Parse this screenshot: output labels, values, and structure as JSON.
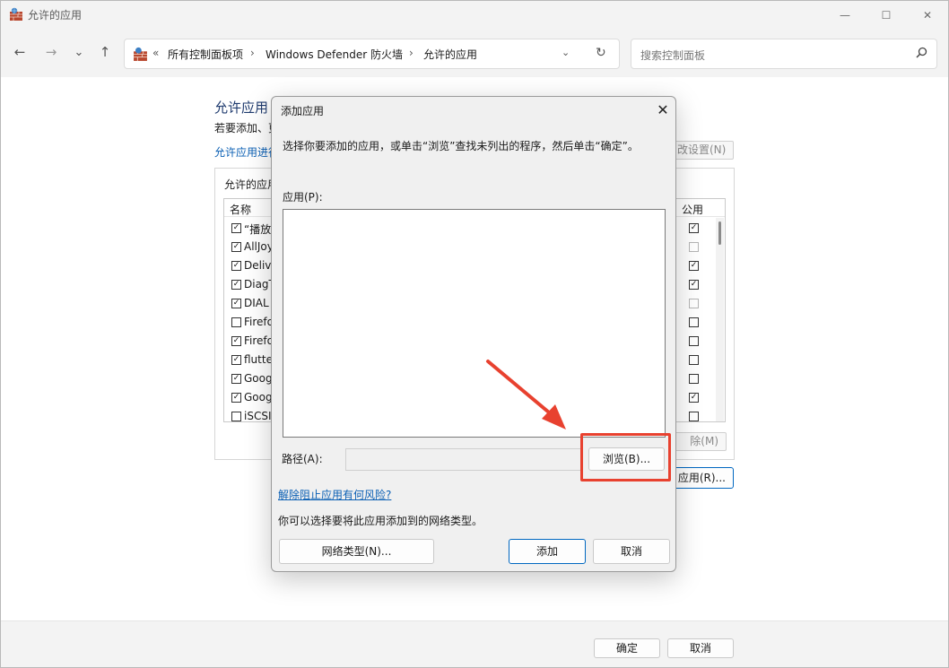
{
  "window": {
    "title": "允许的应用",
    "controls": {
      "minimize": "—",
      "maximize": "☐",
      "close": "✕"
    }
  },
  "nav": {
    "back": "←",
    "forward": "→",
    "recent": "⌄",
    "up": "↑",
    "breadcrumb_prefix": "«",
    "breadcrumbs": [
      "所有控制面板项",
      "Windows Defender 防火墙",
      "允许的应用"
    ],
    "separator": "›",
    "dropdown": "⌄",
    "refresh": "↻",
    "search_placeholder": "搜索控制面板"
  },
  "page": {
    "title": "允许应用",
    "description": "若要添加、更",
    "link": "允许应用进行",
    "change_settings": "改设置(N)",
    "group_label": "允许的应用",
    "columns": {
      "name": "名称",
      "public": "公用"
    },
    "rows": [
      {
        "name": "“播放到",
        "checked": true,
        "public": true,
        "public_disabled": false
      },
      {
        "name": "AllJoy",
        "checked": true,
        "public": false,
        "public_disabled": true
      },
      {
        "name": "Delive",
        "checked": true,
        "public": true,
        "public_disabled": false
      },
      {
        "name": "DiagT",
        "checked": true,
        "public": true,
        "public_disabled": false
      },
      {
        "name": "DIAL",
        "checked": true,
        "public": false,
        "public_disabled": true
      },
      {
        "name": "Firefo",
        "checked": false,
        "public": false,
        "public_disabled": false
      },
      {
        "name": "Firefo",
        "checked": true,
        "public": false,
        "public_disabled": false
      },
      {
        "name": "flutter",
        "checked": true,
        "public": false,
        "public_disabled": false
      },
      {
        "name": "Goog",
        "checked": true,
        "public": false,
        "public_disabled": false
      },
      {
        "name": "Goog",
        "checked": true,
        "public": true,
        "public_disabled": false
      },
      {
        "name": "iSCSI",
        "checked": false,
        "public": false,
        "public_disabled": false
      }
    ],
    "delete_button": "除(M)",
    "allow_other_button": "应用(R)..."
  },
  "footer": {
    "ok": "确定",
    "cancel": "取消"
  },
  "dialog": {
    "title": "添加应用",
    "close": "✕",
    "instruction": "选择你要添加的应用，或单击“浏览”查找未列出的程序，然后单击“确定”。",
    "apps_label": "应用(P):",
    "path_label": "路径(A):",
    "path_value": "",
    "browse_button": "浏览(B)...",
    "risk_link": "解除阻止应用有何风险?",
    "network_note": "你可以选择要将此应用添加到的网络类型。",
    "network_types_button": "网络类型(N)...",
    "add_button": "添加",
    "cancel_button": "取消"
  },
  "colors": {
    "accent": "#0067c0",
    "link": "#0a5fb4",
    "annotation": "#e8412f"
  },
  "checkbox_glyph": "✓"
}
